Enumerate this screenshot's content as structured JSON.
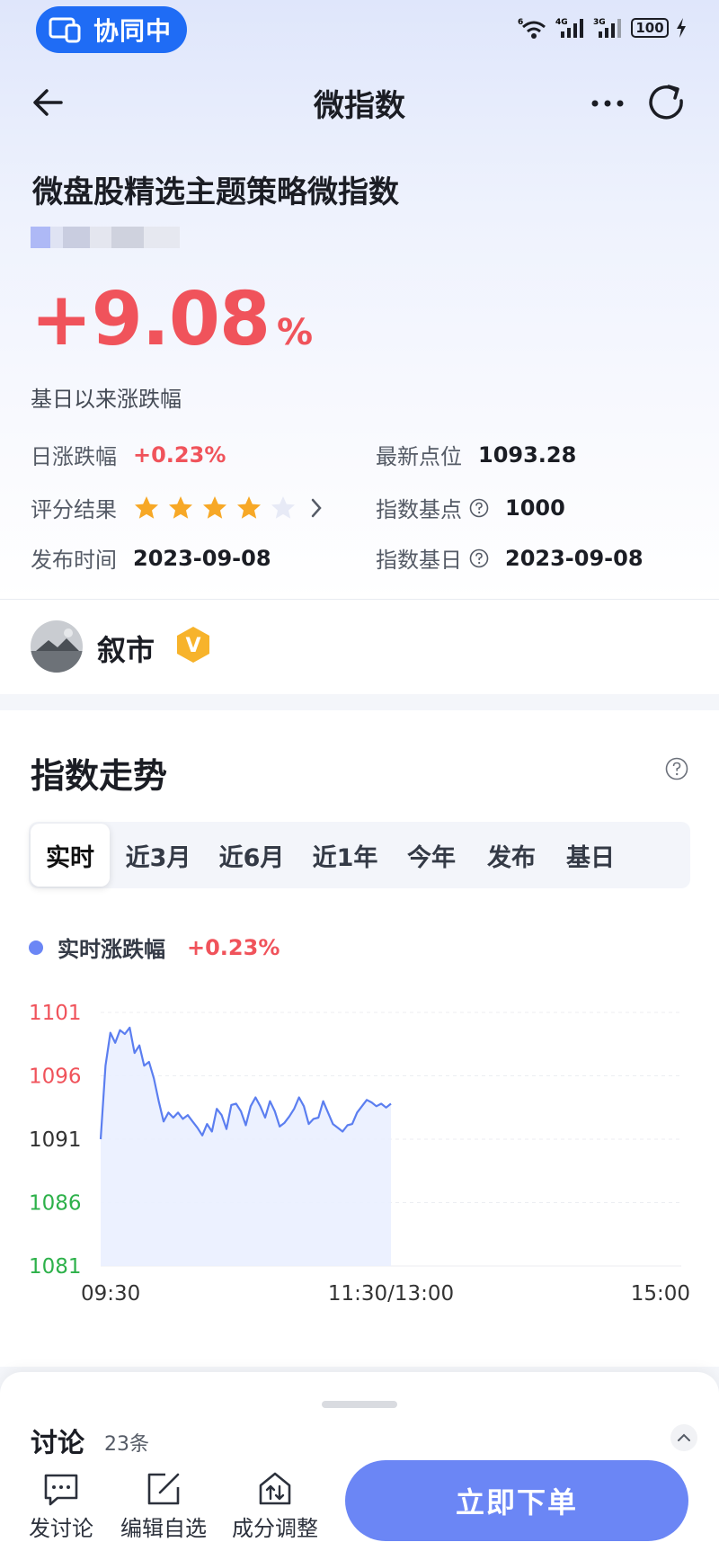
{
  "status_bar": {
    "collab_label": "协同中",
    "battery": "100",
    "wifi_tag": "6",
    "sig1_tag": "4G",
    "sig2_tag": "3G"
  },
  "nav": {
    "title": "微指数"
  },
  "index": {
    "name": "微盘股精选主题策略微指数",
    "change_since_base": "+9.08",
    "change_unit": "%",
    "since_label": "基日以来涨跌幅",
    "daily_change_label": "日涨跌幅",
    "daily_change_value": "+0.23%",
    "latest_label": "最新点位",
    "latest_value": "1093.28",
    "rating_label": "评分结果",
    "rating_stars": 4,
    "rating_max": 5,
    "base_point_label": "指数基点",
    "base_point_value": "1000",
    "publish_label": "发布时间",
    "publish_value": "2023-09-08",
    "base_date_label": "指数基日",
    "base_date_value": "2023-09-08"
  },
  "author": {
    "name": "叙市",
    "badge": "V"
  },
  "trend": {
    "title": "指数走势",
    "tabs": [
      "实时",
      "近3月",
      "近6月",
      "近1年",
      "今年",
      "发布",
      "基日"
    ],
    "active_tab": 0,
    "legend_label": "实时涨跌幅",
    "legend_value": "+0.23%"
  },
  "chart_data": {
    "type": "area",
    "y_ticks": [
      "1101",
      "1096",
      "1091",
      "1086",
      "1081"
    ],
    "x_ticks": [
      "09:30",
      "11:30/13:00",
      "15:00"
    ],
    "ylim": [
      1081,
      1101
    ],
    "colors": {
      "line": "#5b7ef0",
      "fill": "#eaefff",
      "up": "#f0535b",
      "down": "#2db14a",
      "neutral": "#333333"
    },
    "series": [
      {
        "x_minutes": [
          0,
          2,
          4,
          6,
          8,
          10,
          12,
          14,
          16,
          18,
          20,
          22,
          24,
          26,
          28,
          30,
          32,
          34,
          36,
          38,
          40,
          42,
          44,
          46,
          48,
          50,
          52,
          54,
          56,
          58,
          60,
          62,
          64,
          66,
          68,
          70,
          72,
          74,
          76,
          78,
          80,
          82,
          84,
          86,
          88,
          90,
          92,
          94,
          96,
          98,
          100,
          102,
          104,
          106,
          108,
          110,
          112,
          114,
          116,
          118,
          120
        ],
        "values": [
          1091.0,
          1096.8,
          1099.4,
          1098.6,
          1099.6,
          1099.3,
          1099.8,
          1097.8,
          1098.4,
          1096.8,
          1097.1,
          1095.8,
          1094.0,
          1092.4,
          1093.1,
          1092.7,
          1093.1,
          1092.6,
          1092.9,
          1092.4,
          1091.9,
          1091.3,
          1092.2,
          1091.6,
          1093.4,
          1092.9,
          1091.8,
          1093.7,
          1093.8,
          1093.2,
          1092.1,
          1093.6,
          1094.3,
          1093.6,
          1092.7,
          1094.0,
          1093.2,
          1092.0,
          1092.3,
          1092.8,
          1093.4,
          1094.3,
          1093.6,
          1092.2,
          1092.6,
          1092.7,
          1094.0,
          1093.1,
          1092.2,
          1091.9,
          1091.6,
          1092.1,
          1092.2,
          1093.1,
          1093.6,
          1094.1,
          1093.9,
          1093.6,
          1093.8,
          1093.5,
          1093.8
        ]
      }
    ]
  },
  "discussion": {
    "title": "讨论",
    "count": "23条"
  },
  "actions": {
    "post": "发讨论",
    "edit_watchlist": "编辑自选",
    "constituent_adjust": "成分调整",
    "order": "立即下单"
  }
}
